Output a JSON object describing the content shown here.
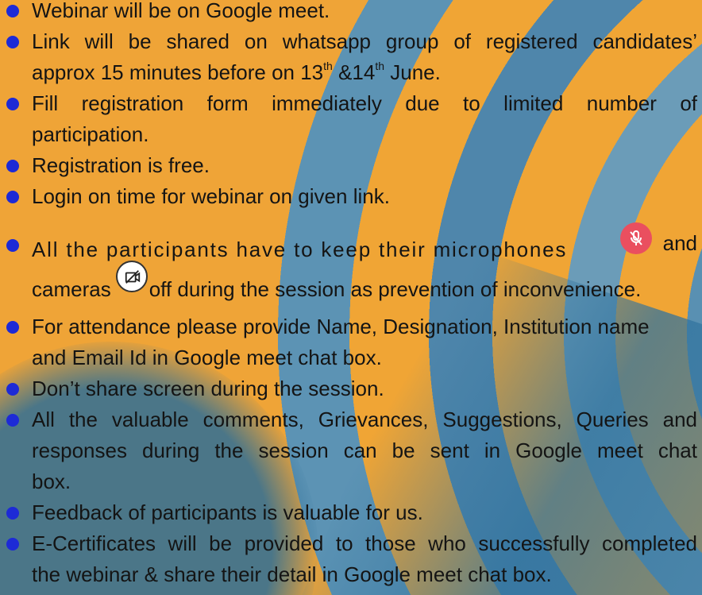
{
  "items": [
    {
      "lines": [
        "Webinar will be on Google meet."
      ]
    },
    {
      "lines": [
        "Link will be shared on whatsapp group of registered candidates’"
      ],
      "l2a": "approx 15 minutes before on 13",
      "l2sup1": "th",
      "l2b": " &14",
      "l2sup2": "th",
      "l2c": " June."
    },
    {
      "lines": [
        "Fill registration form immediately due to limited number of",
        "participation."
      ]
    },
    {
      "lines": [
        "Registration is free."
      ]
    },
    {
      "lines": [
        "Login on time for webinar on given link."
      ]
    },
    {
      "l1a": "All the participants have to keep their microphones",
      "l1b": "and",
      "l2a": "cameras",
      "l2b": "off during the session as prevention of inconvenience."
    },
    {
      "lines": [
        "For attendance please provide Name, Designation, Institution name",
        "and Email Id in Google meet chat box."
      ]
    },
    {
      "lines": [
        "Don’t share screen during the session."
      ]
    },
    {
      "lines": [
        "All the valuable comments, Grievances, Suggestions, Queries and",
        "responses during the session can be sent in Google meet chat",
        "box."
      ]
    },
    {
      "lines": [
        "Feedback of participants is valuable for us."
      ]
    },
    {
      "lines": [
        "E-Certificates will be provided to those who successfully completed",
        "the webinar & share their detail in Google meet chat box."
      ]
    }
  ],
  "icons": {
    "microphone": "microphone-off-icon",
    "camera": "camera-off-icon"
  },
  "colors": {
    "bullet": "#1d2ad6",
    "orange": "#f0a535",
    "blue": "#4c82a8",
    "mic": "#ea4f5f"
  }
}
